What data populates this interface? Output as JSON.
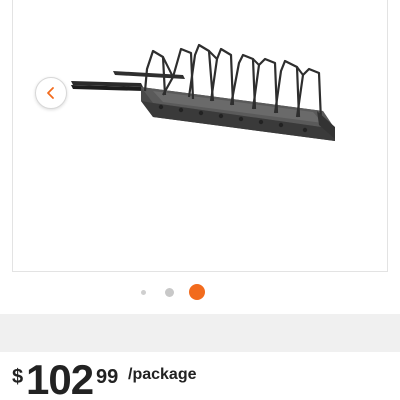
{
  "product_image": {
    "alt": "Pull-out pot lid rack organizer",
    "prev_icon": "chevron-left-icon"
  },
  "carousel": {
    "dot_count": 3,
    "active_index": 3,
    "active_color": "#f26b1d",
    "inactive_color": "#cfcfcf"
  },
  "price": {
    "currency": "$",
    "dollars": "102",
    "cents": "99",
    "unit": "/package"
  }
}
